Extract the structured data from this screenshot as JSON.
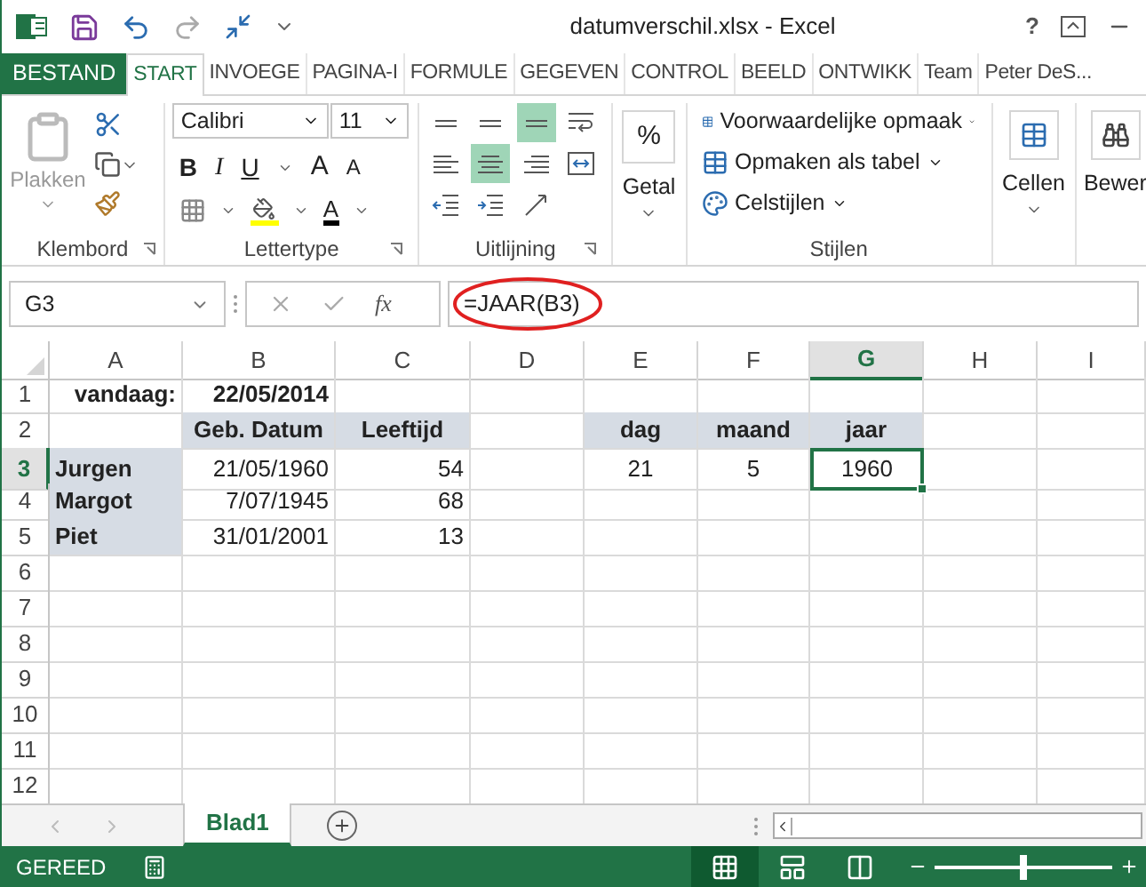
{
  "window": {
    "title": "datumverschil.xlsx - Excel",
    "help": "?"
  },
  "ribbon_tabs": [
    {
      "label": "BESTAND",
      "kind": "file",
      "selected": false
    },
    {
      "label": "START",
      "kind": "tab",
      "selected": true
    },
    {
      "label": "INVOEGE",
      "kind": "tab",
      "selected": false
    },
    {
      "label": "PAGINA-I",
      "kind": "tab",
      "selected": false
    },
    {
      "label": "FORMULE",
      "kind": "tab",
      "selected": false
    },
    {
      "label": "GEGEVEN",
      "kind": "tab",
      "selected": false
    },
    {
      "label": "CONTROL",
      "kind": "tab",
      "selected": false
    },
    {
      "label": "BEELD",
      "kind": "tab",
      "selected": false
    },
    {
      "label": "ONTWIKK",
      "kind": "tab",
      "selected": false
    },
    {
      "label": "Team",
      "kind": "tab",
      "selected": false
    },
    {
      "label": "Peter DeS...",
      "kind": "user",
      "selected": false
    }
  ],
  "ribbon": {
    "clipboard": {
      "label": "Klembord",
      "paste": "Plakken",
      "paste_disabled": true
    },
    "font": {
      "label": "Lettertype",
      "font": "Calibri",
      "size": "11",
      "bold": "B",
      "italic": "I",
      "underline": "U",
      "grow": "A",
      "shrink": "A",
      "font_color_letter": "A"
    },
    "alignment": {
      "label": "Uitlijning",
      "buttons": [
        {
          "kind": "top",
          "selected": false
        },
        {
          "kind": "middle",
          "selected": false
        },
        {
          "kind": "bottom",
          "selected": true
        },
        {
          "kind": "wrap",
          "selected": false
        },
        {
          "kind": "left",
          "selected": false
        },
        {
          "kind": "center",
          "selected": true
        },
        {
          "kind": "right",
          "selected": false
        },
        {
          "kind": "merge",
          "selected": false
        },
        {
          "kind": "outdent",
          "selected": false
        },
        {
          "kind": "indent",
          "selected": false
        },
        {
          "kind": "orientation",
          "selected": false
        }
      ]
    },
    "number": {
      "button": "Getal",
      "symbol": "%"
    },
    "styles": {
      "label": "Stijlen",
      "items": [
        {
          "kind": "conditional",
          "label": "Voorwaardelijke opmaak"
        },
        {
          "kind": "table",
          "label": "Opmaken als tabel"
        },
        {
          "kind": "cellstyles",
          "label": "Celstijlen"
        }
      ]
    },
    "cells": {
      "button": "Cellen"
    },
    "editing": {
      "button": "Bewer"
    }
  },
  "formula_bar": {
    "name_box": "G3",
    "function_label": "fx",
    "formula": "=JAAR(B3)",
    "circled": true
  },
  "sheet": {
    "columns": [
      {
        "label": "A",
        "selected": false
      },
      {
        "label": "B",
        "selected": false
      },
      {
        "label": "C",
        "selected": false
      },
      {
        "label": "D",
        "selected": false
      },
      {
        "label": "E",
        "selected": false
      },
      {
        "label": "F",
        "selected": false
      },
      {
        "label": "G",
        "selected": true
      },
      {
        "label": "H",
        "selected": false
      },
      {
        "label": "I",
        "selected": false
      }
    ],
    "rows": [
      {
        "header": "1",
        "selected": false,
        "cells": [
          {
            "text": "vandaag:",
            "kind": "label",
            "bold": true,
            "shaded": false,
            "selected": false
          },
          {
            "text": "22/05/2014",
            "kind": "number",
            "bold": true,
            "shaded": false,
            "selected": false
          }
        ]
      },
      {
        "header": "2",
        "selected": false,
        "cells": [
          null,
          {
            "text": "Geb. Datum",
            "kind": "heading",
            "bold": true,
            "shaded": true,
            "selected": false
          },
          {
            "text": "Leeftijd",
            "kind": "heading",
            "bold": true,
            "shaded": true,
            "selected": false
          },
          null,
          {
            "text": "dag",
            "kind": "heading",
            "bold": true,
            "shaded": true,
            "selected": false
          },
          {
            "text": "maand",
            "kind": "heading",
            "bold": true,
            "shaded": true,
            "selected": false
          },
          {
            "text": "jaar",
            "kind": "heading",
            "bold": true,
            "shaded": true,
            "selected": false
          }
        ]
      },
      {
        "header": "3",
        "selected": true,
        "cells": [
          {
            "text": "Jurgen",
            "kind": "name",
            "bold": true,
            "shaded": true,
            "selected": false
          },
          {
            "text": "21/05/1960",
            "kind": "number",
            "bold": false,
            "shaded": false,
            "selected": false
          },
          {
            "text": "54",
            "kind": "number",
            "bold": false,
            "shaded": false,
            "selected": false
          },
          null,
          {
            "text": "21",
            "kind": "value",
            "bold": false,
            "shaded": false,
            "selected": false
          },
          {
            "text": "5",
            "kind": "value",
            "bold": false,
            "shaded": false,
            "selected": false
          },
          {
            "text": "1960",
            "kind": "value",
            "bold": false,
            "shaded": false,
            "selected": true
          }
        ]
      },
      {
        "header": "4",
        "selected": false,
        "cells": [
          {
            "text": "Margot",
            "kind": "name",
            "bold": true,
            "shaded": true,
            "selected": false
          },
          {
            "text": "7/07/1945",
            "kind": "number",
            "bold": false,
            "shaded": false,
            "selected": false
          },
          {
            "text": "68",
            "kind": "number",
            "bold": false,
            "shaded": false,
            "selected": false
          }
        ]
      },
      {
        "header": "5",
        "selected": false,
        "cells": [
          {
            "text": "Piet",
            "kind": "name",
            "bold": true,
            "shaded": true,
            "selected": false
          },
          {
            "text": "31/01/2001",
            "kind": "number",
            "bold": false,
            "shaded": false,
            "selected": false
          },
          {
            "text": "13",
            "kind": "number",
            "bold": false,
            "shaded": false,
            "selected": false
          }
        ]
      },
      {
        "header": "6",
        "selected": false
      },
      {
        "header": "7",
        "selected": false
      },
      {
        "header": "8",
        "selected": false
      },
      {
        "header": "9",
        "selected": false
      },
      {
        "header": "10",
        "selected": false
      },
      {
        "header": "11",
        "selected": false
      },
      {
        "header": "12",
        "selected": false
      }
    ]
  },
  "sheet_tabs": [
    {
      "label": "Blad1",
      "selected": true
    }
  ],
  "status_bar": {
    "status": "GEREED",
    "views": [
      {
        "kind": "normal",
        "selected": true
      },
      {
        "kind": "page_layout",
        "selected": false
      },
      {
        "kind": "page_break",
        "selected": false
      }
    ],
    "zoom": {
      "level": 0.5
    }
  }
}
